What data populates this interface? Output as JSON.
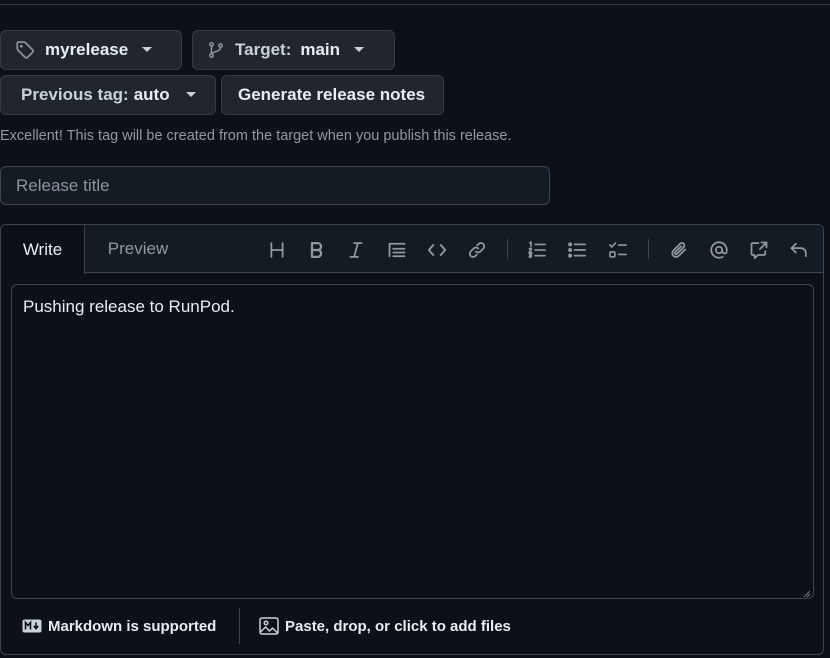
{
  "tag_button": {
    "icon": "tag-icon",
    "label": "myrelease"
  },
  "target_button": {
    "icon": "git-branch-icon",
    "prefix": "Target:",
    "value": "main"
  },
  "previous_tag_button": {
    "prefix": "Previous tag:",
    "value": "auto"
  },
  "generate_button": {
    "label": "Generate release notes"
  },
  "hint": "Excellent! This tag will be created from the target when you publish this release.",
  "release_title": {
    "placeholder": "Release title",
    "value": ""
  },
  "editor": {
    "tabs": [
      "Write",
      "Preview"
    ],
    "active_tab": "Write",
    "toolbar": [
      "heading-icon",
      "bold-icon",
      "italic-icon",
      "quote-icon",
      "code-icon",
      "link-icon",
      "ordered-list-icon",
      "unordered-list-icon",
      "task-list-icon",
      "attach-icon",
      "mention-icon",
      "reference-icon",
      "undo-icon"
    ],
    "body": "Pushing release to RunPod.",
    "footer": {
      "markdown_label": "Markdown is supported",
      "files_label": "Paste, drop, or click to add files"
    }
  },
  "colors": {
    "background": "#0d1117",
    "button_bg": "#21262d",
    "border": "#3d444d",
    "muted_text": "#9198a1",
    "text": "#e6edf3"
  }
}
